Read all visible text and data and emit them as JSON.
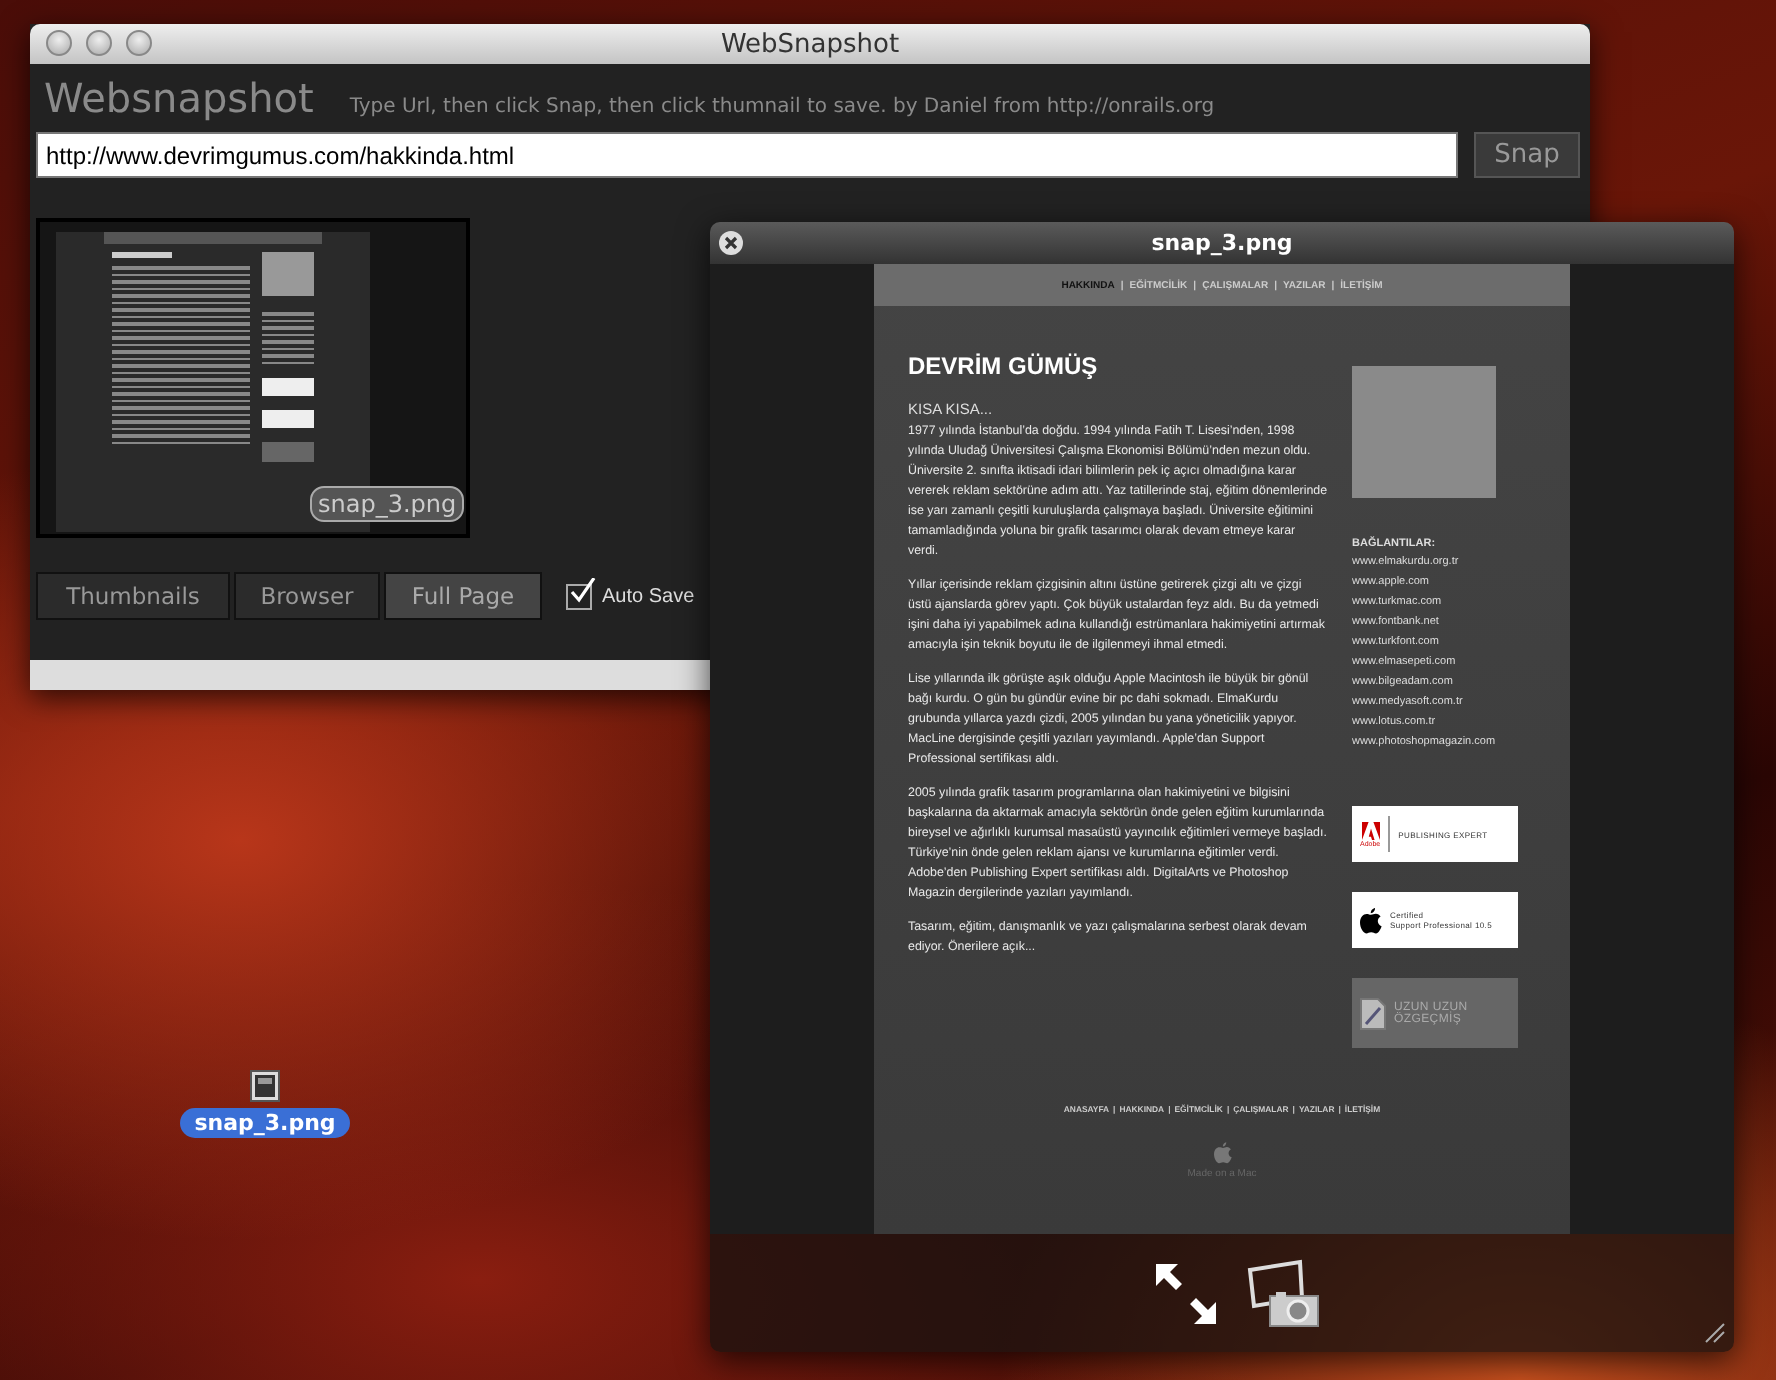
{
  "desktop": {
    "file_icon": {
      "label": "snap_3.png",
      "selected": true
    }
  },
  "main_window": {
    "title": "WebSnapshot",
    "app_name": "Websnapshot",
    "instructions": "Type Url, then click Snap, then click thumnail to save. by Daniel from http://onrails.org",
    "url": {
      "value": "http://www.devrimgumus.com/hakkinda.html"
    },
    "snap_button": "Snap",
    "thumbnails": [
      {
        "label": "snap_3.png"
      }
    ],
    "view_tabs": [
      {
        "label": "Thumbnails",
        "selected": false
      },
      {
        "label": "Browser",
        "selected": false
      },
      {
        "label": "Full Page",
        "selected": true
      }
    ],
    "auto_save": {
      "label": "Auto Save",
      "checked": true
    }
  },
  "preview_window": {
    "title": "snap_3.png",
    "page": {
      "separator": "|",
      "nav": [
        {
          "label": "HAKKINDA",
          "selected": true
        },
        {
          "label": "EĞİTMCİLİK",
          "selected": false
        },
        {
          "label": "ÇALIŞMALAR",
          "selected": false
        },
        {
          "label": "YAZILAR",
          "selected": false
        },
        {
          "label": "İLETİŞİM",
          "selected": false
        }
      ],
      "name": "DEVRİM GÜMÜŞ",
      "subtitle": "KISA KISA...",
      "paragraphs": [
        "1977 yılında İstanbul’da doğdu. 1994 yılında Fatih T. Lisesi’nden, 1998 yılında Uludağ Üniversitesi Çalışma Ekonomisi Bölümü’nden mezun oldu. Üniversite 2. sınıfta iktisadi idari bilimlerin pek iç açıcı olmadığına karar vererek reklam sektörüne adım attı. Yaz tatillerinde staj, eğitim dönemlerinde ise yarı zamanlı çeşitli kuruluşlarda çalışmaya başladı. Üniversite eğitimini tamamladığında yoluna bir grafik tasarımcı olarak devam etmeye karar verdi.",
        "Yıllar içerisinde reklam çizgisinin altını üstüne getirerek çizgi altı ve çizgi üstü ajanslarda görev yaptı. Çok büyük ustalardan feyz aldı. Bu da yetmedi işini daha iyi yapabilmek adına kullandığı estrümanlara hakimiyetini artırmak amacıyla işin teknik boyutu ile de ilgilenmeyi ihmal etmedi.",
        "Lise yıllarında ilk görüşte aşık olduğu Apple Macintosh ile büyük bir gönül bağı kurdu. O gün bu gündür evine bir pc dahi sokmadı. ElmaKurdu grubunda yıllarca yazdı çizdi, 2005 yılından bu yana yöneticilik yapıyor. MacLine dergisinde çeşitli yazıları yayımlandı. Apple’dan Support Professional sertifikası aldı.",
        "2005 yılında grafik tasarım programlarına olan hakimiyetini ve bilgisini başkalarına da aktarmak amacıyla sektörün önde gelen eğitim kurumlarında bireysel ve ağırlıklı kurumsal masaüstü yayıncılık eğitimleri vermeye başladı. Türkiye’nin önde gelen reklam ajansı ve kurumlarına eğitimler verdi. Adobe’den Publishing Expert sertifikası aldı. DigitalArts ve Photoshop Magazin dergilerinde yazıları yayımlandı.",
        "Tasarım, eğitim, danışmanlık ve yazı çalışmalarına serbest olarak devam ediyor. Önerilere açık..."
      ],
      "links_heading": "BAĞLANTILAR:",
      "links": [
        "www.elmakurdu.org.tr",
        "www.apple.com",
        "www.turkmac.com",
        "www.fontbank.net",
        "www.turkfont.com",
        "www.elmasepeti.com",
        "www.bilgeadam.com",
        "www.medyasoft.com.tr",
        "www.lotus.com.tr",
        "www.photoshopmagazin.com"
      ],
      "badges": [
        {
          "kind": "adobe",
          "brand": "Adobe",
          "lines": [
            "PUBLISHING EXPERT"
          ]
        },
        {
          "kind": "apple",
          "lines": [
            "Certified",
            "Support Professional 10.5"
          ]
        },
        {
          "kind": "resume",
          "lines": [
            "UZUN UZUN",
            "ÖZGEÇMİŞ"
          ]
        }
      ],
      "footer_nav": [
        "ANASAYFA",
        "HAKKINDA",
        "EĞİTMCİLİK",
        "ÇALIŞMALAR",
        "YAZILAR",
        "İLETİŞİM"
      ],
      "made_on": "Made on a Mac"
    }
  }
}
